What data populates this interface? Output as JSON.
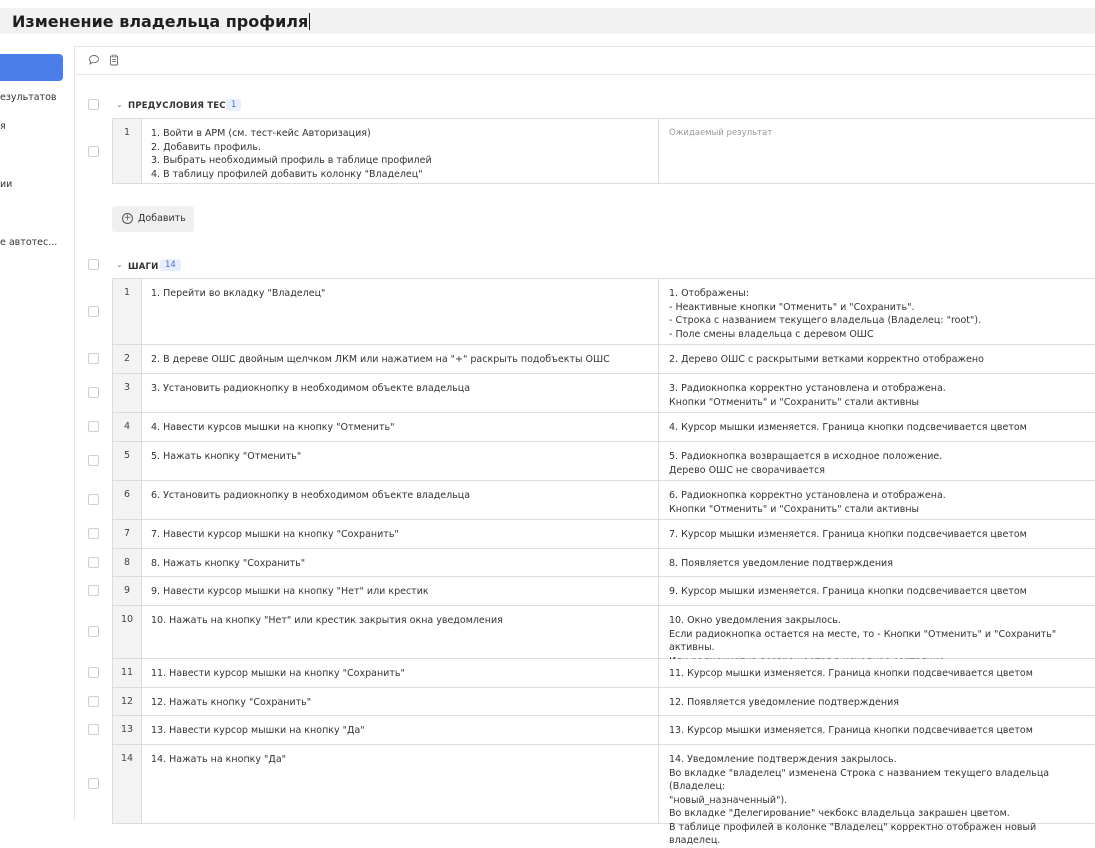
{
  "header": {
    "title": "Изменение владельца профиля"
  },
  "sidebar": {
    "items": [
      "езультатов",
      "я",
      "ии",
      "е автотес..."
    ]
  },
  "toolbar": {
    "icons": [
      "comment-icon",
      "clipboard-icon"
    ]
  },
  "preconditions": {
    "section_label": "ПРЕДУСЛОВИЯ ТЕСТА",
    "count": "1",
    "rows": [
      {
        "num": "1",
        "step": "1. Войти в АРМ (см. тест-кейс Авторизация)\n2. Добавить профиль.\n3. Выбрать необходимый профиль в таблице профилей\n4. В таблицу профилей добавить колонку \"Владелец\"",
        "expected_placeholder": "Ожидаемый результат"
      }
    ],
    "add_label": "Добавить"
  },
  "steps": {
    "section_label": "ШАГИ",
    "count": "14",
    "rows": [
      {
        "num": "1",
        "step": "1. Перейти во вкладку \"Владелец\"",
        "expected": "1. Отображены:\n- Неактивные кнопки \"Отменить\" и \"Сохранить\".\n- Строка с названием текущего владельца (Владелец: \"root\").\n- Поле смены владельца с деревом ОШС"
      },
      {
        "num": "2",
        "step": "2. В дереве ОШС двойным щелчком ЛКМ или нажатием на \"+\" раскрыть подобъекты ОШС",
        "expected": "2. Дерево ОШС с раскрытыми ветками корректно отображено"
      },
      {
        "num": "3",
        "step": "3. Установить радиокнопку в необходимом объекте владельца",
        "expected": "3. Радиокнопка корректно установлена и отображена.\nКнопки \"Отменить\" и \"Сохранить\" стали активны"
      },
      {
        "num": "4",
        "step": "4. Навести курсов мышки на кнопку \"Отменить\"",
        "expected": "4. Курсор мышки изменяется. Граница кнопки подсвечивается цветом"
      },
      {
        "num": "5",
        "step": "5. Нажать кнопку \"Отменить\"",
        "expected": "5. Радиокнопка возвращается в исходное положение.\nДерево ОШС не сворачивается"
      },
      {
        "num": "6",
        "step": "6. Установить радиокнопку в необходимом объекте владельца",
        "expected": "6. Радиокнопка корректно установлена и отображена.\nКнопки \"Отменить\" и \"Сохранить\" стали активны"
      },
      {
        "num": "7",
        "step": "7. Навести курсор мышки на кнопку \"Сохранить\"",
        "expected": "7. Курсор мышки изменяется. Граница кнопки подсвечивается цветом"
      },
      {
        "num": "8",
        "step": "8. Нажать кнопку \"Сохранить\"",
        "expected": "8. Появляется уведомление подтверждения"
      },
      {
        "num": "9",
        "step": "9. Навести курсор мышки на кнопку \"Нет\" или крестик",
        "expected": "9. Курсор мышки изменяется. Граница кнопки подсвечивается цветом"
      },
      {
        "num": "10",
        "step": "10. Нажать на кнопку \"Нет\" или крестик закрытия окна уведомления",
        "expected": "10. Окно уведомления закрылось.\nЕсли радиокнопка остается на месте, то - Кнопки \"Отменить\" и \"Сохранить\" активны.\nИли радиокнопка возвращается в исходное состояние"
      },
      {
        "num": "11",
        "step": "11. Навести курсор мышки на кнопку \"Сохранить\"",
        "expected": "11. Курсор мышки изменяется. Граница кнопки подсвечивается цветом"
      },
      {
        "num": "12",
        "step": "12. Нажать кнопку \"Сохранить\"",
        "expected": "12. Появляется уведомление подтверждения"
      },
      {
        "num": "13",
        "step": "13. Навести курсор мышки на кнопку \"Да\"",
        "expected": "13. Курсор мышки изменяется. Граница кнопки подсвечивается цветом"
      },
      {
        "num": "14",
        "step": "14. Нажать на кнопку \"Да\"",
        "expected": "14. Уведомление подтверждения закрылось.\nВо вкладке \"владелец\" изменена Строка с названием текущего владельца (Владелец:\n\"новый_назначенный\").\nВо вкладке \"Делегирование\" чекбокс владельца закрашен цветом.\nВ таблице профилей в колонке \"Владелец\" корректно отображен новый владелец."
      }
    ]
  },
  "colors": {
    "accent": "#4a7de8",
    "badge_bg": "#e6edfb",
    "badge_text": "#4a6fd0"
  }
}
